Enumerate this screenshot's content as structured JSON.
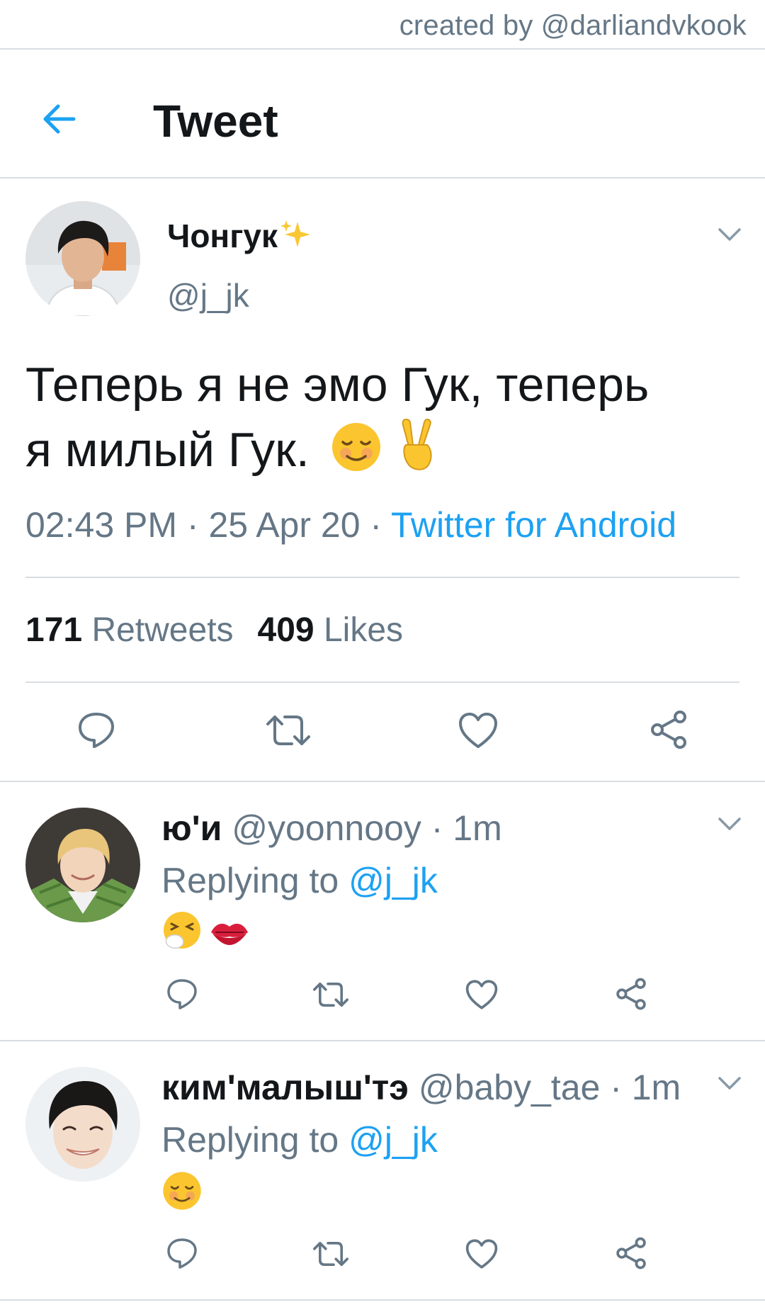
{
  "credit": "created by @darliandvkook",
  "header": {
    "title": "Tweet"
  },
  "tweet": {
    "author_name": "Чонгук",
    "author_handle": "@j_jk",
    "text_line1": "Теперь я не эмо Гук, теперь",
    "text_line2": "я милый Гук.",
    "time": "02:43 PM",
    "date": "25 Apr 20",
    "separator": " · ",
    "source": "Twitter for Android",
    "retweets_count": "171",
    "retweets_label": "Retweets",
    "likes_count": "409",
    "likes_label": "Likes"
  },
  "replies": [
    {
      "name": "ю'и",
      "handle": "@yoonnooy",
      "time": "1m",
      "replying_prefix": "Replying to",
      "replying_to": "@j_jk",
      "emojis": [
        "sneezing-face",
        "kiss-mark"
      ]
    },
    {
      "name": "ким'малыш'тэ",
      "handle": "@baby_tae",
      "time": "1m",
      "replying_prefix": "Replying to",
      "replying_to": "@j_jk",
      "emojis": [
        "smiling-face"
      ]
    }
  ],
  "icons": {
    "back": "arrow-left-icon",
    "menu": "chevron-down-icon",
    "reply": "reply-bubble-icon",
    "retweet": "retweet-icon",
    "like": "heart-icon",
    "share": "share-icon",
    "sparkles": "sparkles-icon"
  },
  "colors": {
    "accent": "#1da1f2",
    "text_primary": "#14171a",
    "text_secondary": "#657786",
    "divider": "#d9dde1"
  }
}
